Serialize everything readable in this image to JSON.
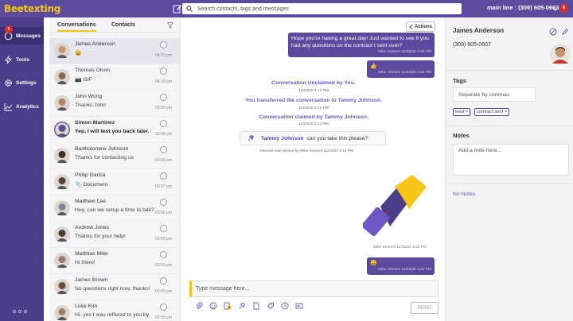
{
  "app": {
    "logo": "Beetexting"
  },
  "topbar": {
    "search_placeholder": "Search contacts, tags and messages",
    "line_label": "main line",
    "line_number": "(309) 605-0663",
    "notification_count": "4"
  },
  "nav": {
    "messages_badge": "1",
    "items": [
      {
        "label": "Messages"
      },
      {
        "label": "Tools"
      },
      {
        "label": "Settings"
      },
      {
        "label": "Analytics"
      }
    ]
  },
  "conversations": {
    "tabs": [
      {
        "label": "Conversations"
      },
      {
        "label": "Contacts"
      }
    ],
    "items": [
      {
        "name": "James Anderson",
        "message": "😀",
        "time": "04:23 pm",
        "bold": false,
        "avatar_color": "#c9926e"
      },
      {
        "name": "Thomas Olson",
        "message": "📷 GIF",
        "time": "04:19 pm",
        "bold": false,
        "avatar_color": "#8a6a55"
      },
      {
        "name": "John Wong",
        "message": "Thanks John",
        "time": "03:59 pm",
        "bold": false,
        "avatar_color": "#b58462"
      },
      {
        "name": "Simon Martinez",
        "message": "Yep, I will text you back later.",
        "time": "03:58 pm",
        "bold": true,
        "avatar_color": "#5b4a9e"
      },
      {
        "name": "Bartholomew Johnson",
        "message": "Thanks for contacting us",
        "time": "03:58 pm",
        "bold": false,
        "avatar_color": "#3b2f2a"
      },
      {
        "name": "Philip Garzia",
        "message": "📎 Document",
        "time": "03:57 pm",
        "bold": false,
        "avatar_color": "#5a4038"
      },
      {
        "name": "Matthew Lee",
        "message": "Hey, can we setup a time to talk?",
        "time": "03:56 pm",
        "bold": false,
        "avatar_color": "#7a8aa0"
      },
      {
        "name": "Andrew Jones",
        "message": "Thanks for your help!",
        "time": "03:55 pm",
        "bold": false,
        "avatar_color": "#4a3a32"
      },
      {
        "name": "Matthias Miler",
        "message": "Hi there!",
        "time": "03:55 pm",
        "bold": false,
        "avatar_color": "#9a7a6a"
      },
      {
        "name": "James Brown",
        "message": "No questions right now, thanks!",
        "time": "03:55 pm",
        "bold": false,
        "avatar_color": "#6b4a3a"
      },
      {
        "name": "Luke Kim",
        "message": "Hi, yes I was reffered to you by",
        "time": "03:55 pm",
        "bold": false,
        "avatar_color": "#a08070"
      }
    ]
  },
  "chat": {
    "actions_label": "Actions",
    "outgoing_top": {
      "text1": "Hope you're having a great day! Just wanted to see if you",
      "text2": "had any questions on the contract I sent over?",
      "meta": "Mike Somers  11/03/20 3:40 PM"
    },
    "outgoing_thumb": {
      "emoji": "👍",
      "meta": "Mike Somers  11/03/20 3:55 PM"
    },
    "system": [
      {
        "text": "Conversation Unclaimed by You.",
        "time": "11/03/20 4:14 PM"
      },
      {
        "text": "You transferred the conversation to Tammy Johnson.",
        "time": "11/03/20 4:14 PM"
      },
      {
        "text": "Conversation claimed by Tammy Johnson.",
        "time": "11/03/20 4:14 PM"
      }
    ],
    "internal_note": {
      "who": "Tammy Johnson",
      "text": "can you take this please?",
      "caption": "Internal note posted by Mike Somers  11/03/20 4:14 PM"
    },
    "gif_meta": "Mike Somers  11/03/20 4:23 PM",
    "outgoing_last": {
      "emoji": "😀",
      "meta": "Mike Somers  11/03/20 4:23 PM"
    },
    "input_placeholder": "Type message here...",
    "send_label": "SEND"
  },
  "contact": {
    "name": "James Anderson",
    "phone": "(309) 605-0607",
    "tags_label": "Tags",
    "tags_placeholder": "Separate by commas",
    "tags": [
      "lead",
      "contract sent"
    ],
    "notes_label": "Notes",
    "notes_placeholder": "Add a note here...",
    "no_notes": "No Notes"
  },
  "colors": {
    "brand": "#5b4a9e",
    "accent": "#f5c518",
    "alert": "#d62d2d"
  }
}
